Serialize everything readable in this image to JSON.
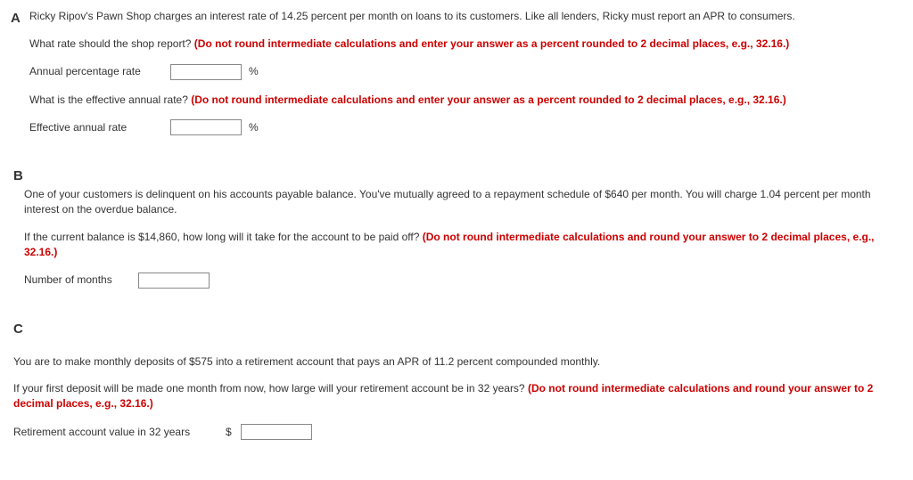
{
  "A": {
    "letter": "A",
    "intro": "Ricky Ripov's Pawn Shop charges an interest rate of 14.25 percent per month on loans to its customers. Like all lenders, Ricky must report an APR to consumers.",
    "q1_prompt": "What rate should the shop report? ",
    "q1_instruction": "(Do not round intermediate calculations and enter your answer as a percent rounded to 2 decimal places, e.g., 32.16.)",
    "apr_label": "Annual percentage rate",
    "apr_unit": "%",
    "q2_prompt": "What is the effective annual rate? ",
    "q2_instruction": "(Do not round intermediate calculations and enter your answer as a percent rounded to 2 decimal places, e.g., 32.16.)",
    "ear_label": "Effective annual rate",
    "ear_unit": "%"
  },
  "B": {
    "letter": "B",
    "intro": "One of your customers is delinquent on his accounts payable balance. You've mutually agreed to a repayment schedule of $640 per month. You will charge 1.04 percent per month interest on the overdue balance.",
    "q_prompt": "If the current balance is $14,860, how long will it take for the account to be paid off? ",
    "q_instruction": "(Do not round intermediate calculations and round your answer to 2 decimal places, e.g., 32.16.)",
    "months_label": "Number of months"
  },
  "C": {
    "letter": "C",
    "intro": "You are to make monthly deposits of $575 into a retirement account that pays an APR of 11.2 percent compounded monthly.",
    "q_prompt": "If your first deposit will be made one month from now, how large will your retirement account be in 32 years? ",
    "q_instruction": "(Do not round intermediate calculations and round your answer to 2 decimal places, e.g., 32.16.)",
    "value_label": "Retirement account value in 32 years",
    "value_prefix": "$"
  }
}
